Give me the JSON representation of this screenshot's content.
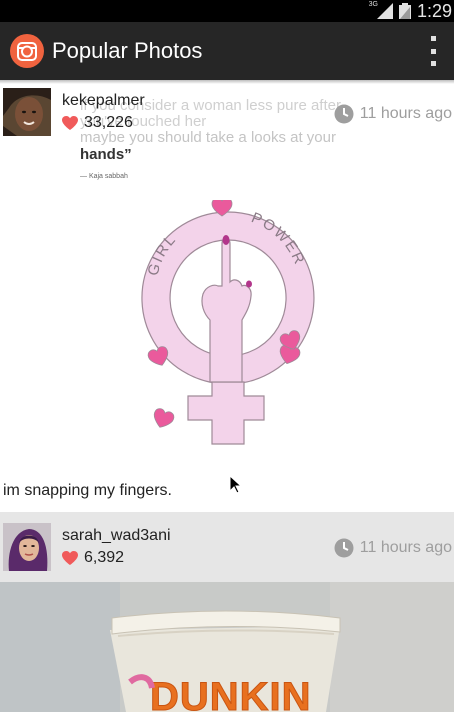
{
  "status_bar": {
    "time": "1:29",
    "network": "3G"
  },
  "app_bar": {
    "title": "Popular Photos",
    "icon": "camera-app-icon",
    "bar_color": "#262626",
    "icon_color": "#f0633f"
  },
  "posts": [
    {
      "username": "kekepalmer",
      "likes": "33,226",
      "time_ago": "11 hours ago",
      "caption": "im snapping my fingers.",
      "image": {
        "quote_lines": [
          "if you consider a woman less pure after",
          "you've touched her",
          "maybe you should take a looks at your"
        ],
        "quote_emphasis": "hands”",
        "quote_author": "— Kaja sabbah",
        "ring_text_left": "GIRL",
        "ring_text_right": "POWER"
      }
    },
    {
      "username": "sarah_wad3ani",
      "likes": "6,392",
      "time_ago": "11 hours ago",
      "image": {
        "brand_text": "DUNKIN"
      }
    }
  ],
  "colors": {
    "heart": "#f05a5a",
    "clock": "#9e9e9e",
    "post_header_bg": "#e6e6e6",
    "symbol_fill": "#f3d3ea",
    "heart_pink": "#ea5a9c"
  }
}
